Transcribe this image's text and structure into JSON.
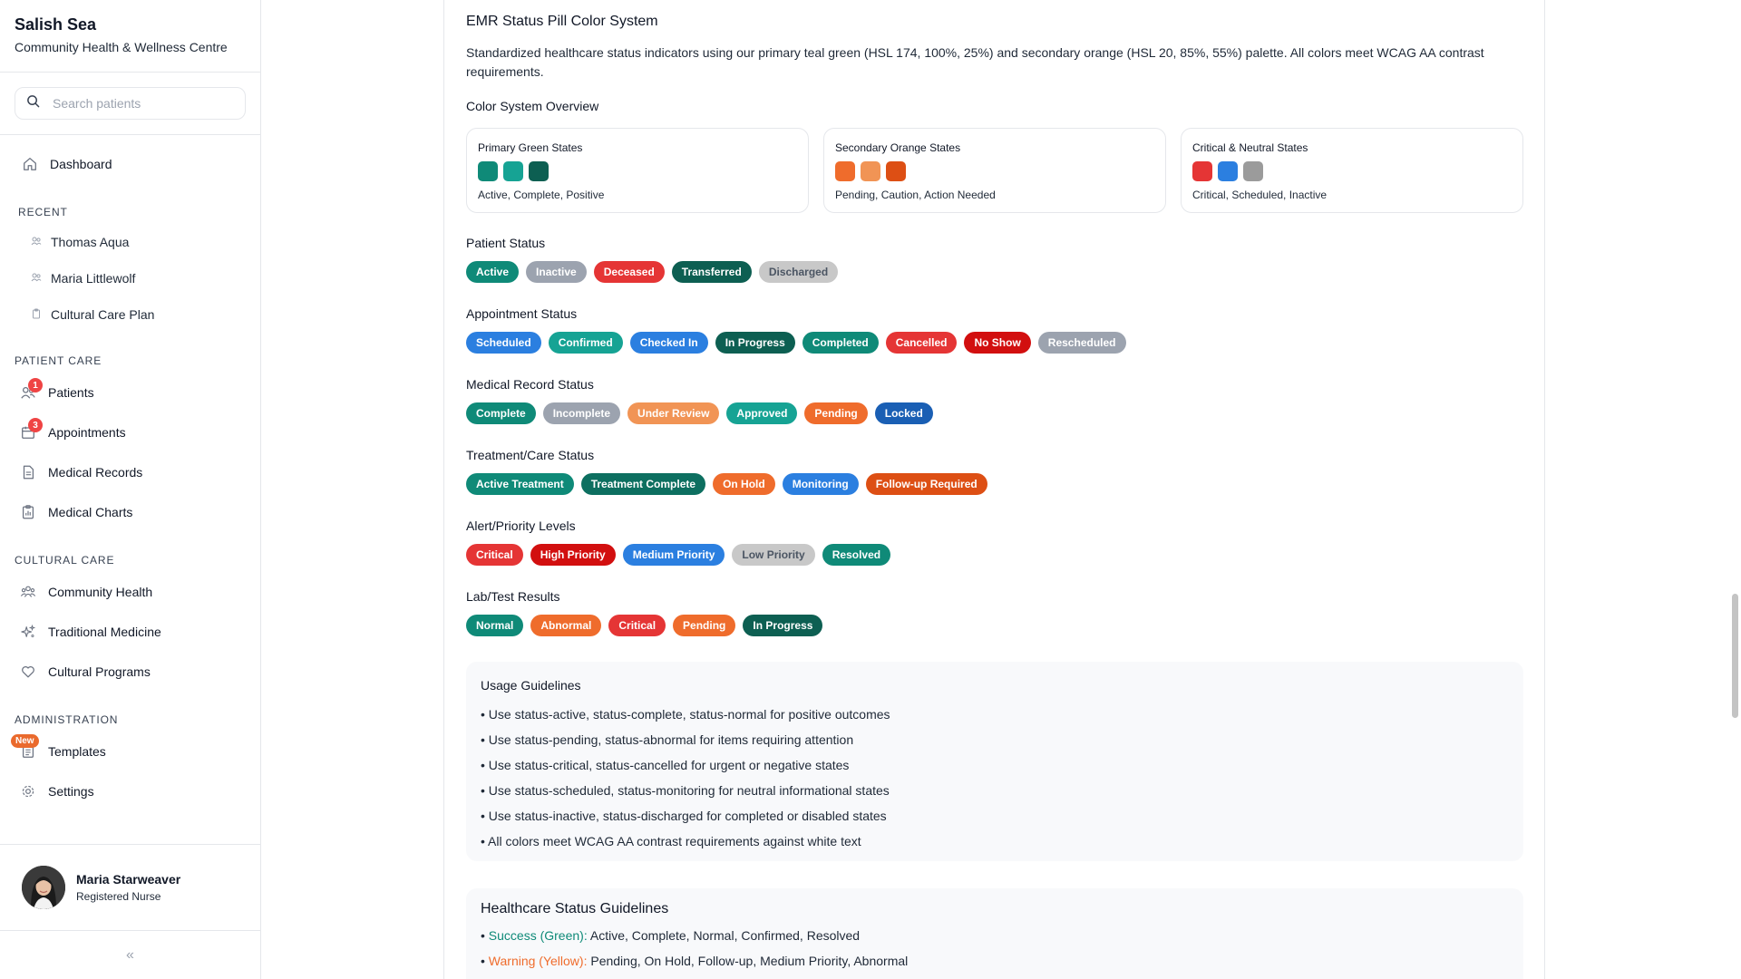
{
  "brand": {
    "title": "Salish Sea",
    "subtitle": "Community Health & Wellness Centre"
  },
  "search": {
    "placeholder": "Search patients"
  },
  "nav": {
    "dashboard": "Dashboard",
    "recent_title": "RECENT",
    "recent": [
      "Thomas Aqua",
      "Maria Littlewolf",
      "Cultural Care Plan"
    ],
    "patient_care_title": "PATIENT CARE",
    "patients": "Patients",
    "patients_badge": "1",
    "appointments": "Appointments",
    "appointments_badge": "3",
    "medical_records": "Medical Records",
    "medical_charts": "Medical Charts",
    "cultural_care_title": "CULTURAL CARE",
    "community_health": "Community Health",
    "traditional_medicine": "Traditional Medicine",
    "cultural_programs": "Cultural Programs",
    "administration_title": "ADMINISTRATION",
    "templates": "Templates",
    "templates_badge": "New",
    "settings": "Settings"
  },
  "user": {
    "name": "Maria Starweaver",
    "role": "Registered Nurse"
  },
  "collapse_glyph": "«",
  "main": {
    "title": "EMR Status Pill Color System",
    "description": "Standardized healthcare status indicators using our primary teal green (HSL 174, 100%, 25%) and secondary orange (HSL 20, 85%, 55%) palette. All colors meet WCAG AA contrast requirements.",
    "overview_title": "Color System Overview",
    "overview": [
      {
        "title": "Primary Green States",
        "colors": [
          "#0f8a78",
          "#16a394",
          "#0d5f52"
        ],
        "subtitle": "Active, Complete, Positive"
      },
      {
        "title": "Secondary Orange States",
        "colors": [
          "#ef6c2c",
          "#f19455",
          "#dd4f14"
        ],
        "subtitle": "Pending, Caution, Action Needed"
      },
      {
        "title": "Critical & Neutral States",
        "colors": [
          "#e53535",
          "#2b7fe0",
          "#9b9b9b"
        ],
        "subtitle": "Critical, Scheduled, Inactive"
      }
    ],
    "groups": [
      {
        "title": "Patient Status",
        "pills": [
          {
            "label": "Active",
            "color": "#0f8a78",
            "text": "#ffffff"
          },
          {
            "label": "Inactive",
            "color": "#9ca3af",
            "text": "#ffffff"
          },
          {
            "label": "Deceased",
            "color": "#e53535",
            "text": "#ffffff"
          },
          {
            "label": "Transferred",
            "color": "#0d5f52",
            "text": "#ffffff"
          },
          {
            "label": "Discharged",
            "color": "#c8c8c8",
            "text": "#4b5563"
          }
        ]
      },
      {
        "title": "Appointment Status",
        "pills": [
          {
            "label": "Scheduled",
            "color": "#2b7fe0",
            "text": "#ffffff"
          },
          {
            "label": "Confirmed",
            "color": "#16a394",
            "text": "#ffffff"
          },
          {
            "label": "Checked In",
            "color": "#2b7fe0",
            "text": "#ffffff"
          },
          {
            "label": "In Progress",
            "color": "#0d5f52",
            "text": "#ffffff"
          },
          {
            "label": "Completed",
            "color": "#0f8a78",
            "text": "#ffffff"
          },
          {
            "label": "Cancelled",
            "color": "#e53535",
            "text": "#ffffff"
          },
          {
            "label": "No Show",
            "color": "#d20f0f",
            "text": "#ffffff"
          },
          {
            "label": "Rescheduled",
            "color": "#9ca3af",
            "text": "#ffffff"
          }
        ]
      },
      {
        "title": "Medical Record Status",
        "pills": [
          {
            "label": "Complete",
            "color": "#0f8a78",
            "text": "#ffffff"
          },
          {
            "label": "Incomplete",
            "color": "#9ca3af",
            "text": "#ffffff"
          },
          {
            "label": "Under Review",
            "color": "#f19455",
            "text": "#ffffff"
          },
          {
            "label": "Approved",
            "color": "#16a394",
            "text": "#ffffff"
          },
          {
            "label": "Pending",
            "color": "#ef6c2c",
            "text": "#ffffff"
          },
          {
            "label": "Locked",
            "color": "#1a5fb4",
            "text": "#ffffff"
          }
        ]
      },
      {
        "title": "Treatment/Care Status",
        "pills": [
          {
            "label": "Active Treatment",
            "color": "#0f8a78",
            "text": "#ffffff"
          },
          {
            "label": "Treatment Complete",
            "color": "#0d6f60",
            "text": "#ffffff"
          },
          {
            "label": "On Hold",
            "color": "#ef6c2c",
            "text": "#ffffff"
          },
          {
            "label": "Monitoring",
            "color": "#2b7fe0",
            "text": "#ffffff"
          },
          {
            "label": "Follow-up Required",
            "color": "#dd4f14",
            "text": "#ffffff"
          }
        ]
      },
      {
        "title": "Alert/Priority Levels",
        "pills": [
          {
            "label": "Critical",
            "color": "#e53535",
            "text": "#ffffff"
          },
          {
            "label": "High Priority",
            "color": "#d20f0f",
            "text": "#ffffff"
          },
          {
            "label": "Medium Priority",
            "color": "#2b7fe0",
            "text": "#ffffff"
          },
          {
            "label": "Low Priority",
            "color": "#c8c8c8",
            "text": "#4b5563"
          },
          {
            "label": "Resolved",
            "color": "#0f8a78",
            "text": "#ffffff"
          }
        ]
      },
      {
        "title": "Lab/Test Results",
        "pills": [
          {
            "label": "Normal",
            "color": "#0f8a78",
            "text": "#ffffff"
          },
          {
            "label": "Abnormal",
            "color": "#ef6c2c",
            "text": "#ffffff"
          },
          {
            "label": "Critical",
            "color": "#e53535",
            "text": "#ffffff"
          },
          {
            "label": "Pending",
            "color": "#ef6c2c",
            "text": "#ffffff"
          },
          {
            "label": "In Progress",
            "color": "#0d5f52",
            "text": "#ffffff"
          }
        ]
      }
    ],
    "usage": {
      "title": "Usage Guidelines",
      "lines": [
        "• Use status-active, status-complete, status-normal for positive outcomes",
        "• Use status-pending, status-abnormal for items requiring attention",
        "• Use status-critical, status-cancelled for urgent or negative states",
        "• Use status-scheduled, status-monitoring for neutral informational states",
        "• Use status-inactive, status-discharged for completed or disabled states",
        "• All colors meet WCAG AA contrast requirements against white text"
      ]
    },
    "health": {
      "title": "Healthcare Status Guidelines",
      "lines": [
        {
          "bullet": "• ",
          "label": "Success (Green):",
          "label_color": "#0f8a78",
          "text": " Active, Complete, Normal, Confirmed, Resolved"
        },
        {
          "bullet": "• ",
          "label": "Warning (Yellow):",
          "label_color": "#ef6c2c",
          "text": " Pending, On Hold, Follow-up, Medium Priority, Abnormal"
        }
      ]
    }
  }
}
